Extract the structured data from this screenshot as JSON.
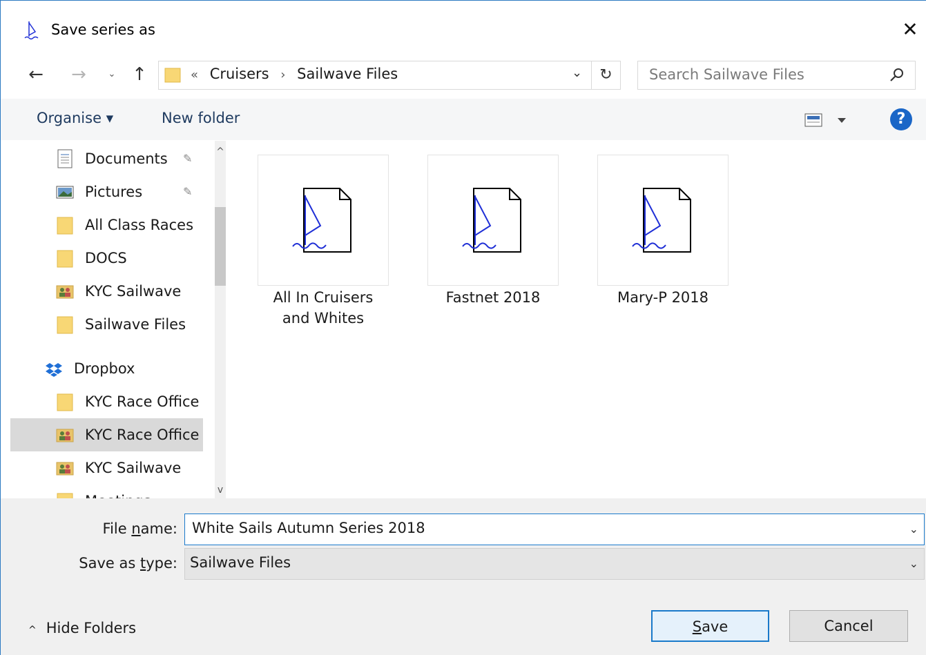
{
  "window": {
    "title": "Save series as",
    "close_glyph": "✕"
  },
  "nav": {
    "back_glyph": "←",
    "forward_glyph": "→",
    "recent_glyph": "⌄",
    "up_glyph": "↑",
    "breadcrumb_overflow": "«",
    "breadcrumbs": [
      "Cruisers",
      "Sailwave Files"
    ],
    "breadcrumb_separator": "›",
    "dropdown_glyph": "⌄",
    "refresh_glyph": "↻",
    "search_placeholder": "Search Sailwave Files"
  },
  "toolbar": {
    "organise_label": "Organise ▾",
    "new_folder_label": "New folder",
    "help_glyph": "?"
  },
  "sidebar": {
    "items": [
      {
        "label": "Documents",
        "icon": "document-icon",
        "pinned": true
      },
      {
        "label": "Pictures",
        "icon": "pictures-icon",
        "pinned": true
      },
      {
        "label": "All Class Races",
        "icon": "folder-icon"
      },
      {
        "label": "DOCS",
        "icon": "folder-icon"
      },
      {
        "label": "KYC Sailwave",
        "icon": "shared-folder-icon"
      },
      {
        "label": "Sailwave Files",
        "icon": "folder-icon"
      },
      {
        "label": "Dropbox",
        "icon": "dropbox-icon"
      },
      {
        "label": "KYC Race Office",
        "icon": "folder-icon"
      },
      {
        "label": "KYC Race Office",
        "icon": "shared-folder-icon",
        "selected": true
      },
      {
        "label": "KYC Sailwave",
        "icon": "shared-folder-icon"
      },
      {
        "label": "Meetings",
        "icon": "folder-icon"
      }
    ],
    "pin_glyph": "📌",
    "scroll_up_glyph": "^",
    "scroll_down_glyph": "v"
  },
  "files": [
    {
      "name_line1": "All In Cruisers",
      "name_line2": "and Whites"
    },
    {
      "name_line1": "Fastnet 2018",
      "name_line2": ""
    },
    {
      "name_line1": "Mary-P 2018",
      "name_line2": ""
    }
  ],
  "form": {
    "filename_label_pre": "File ",
    "filename_label_u": "n",
    "filename_label_post": "ame:",
    "filename_value": "White Sails Autumn Series 2018",
    "type_label_pre": "Save as ",
    "type_label_u": "t",
    "type_label_post": "ype:",
    "type_value": "Sailwave Files",
    "dropdown_glyph": "⌄"
  },
  "footer": {
    "hide_folders_glyph": "^",
    "hide_folders_label": "Hide Folders",
    "save_u": "S",
    "save_rest": "ave",
    "cancel_label": "Cancel"
  },
  "colors": {
    "accent": "#1979ca",
    "help": "#1a66c7",
    "sail": "#1f2fd6"
  }
}
